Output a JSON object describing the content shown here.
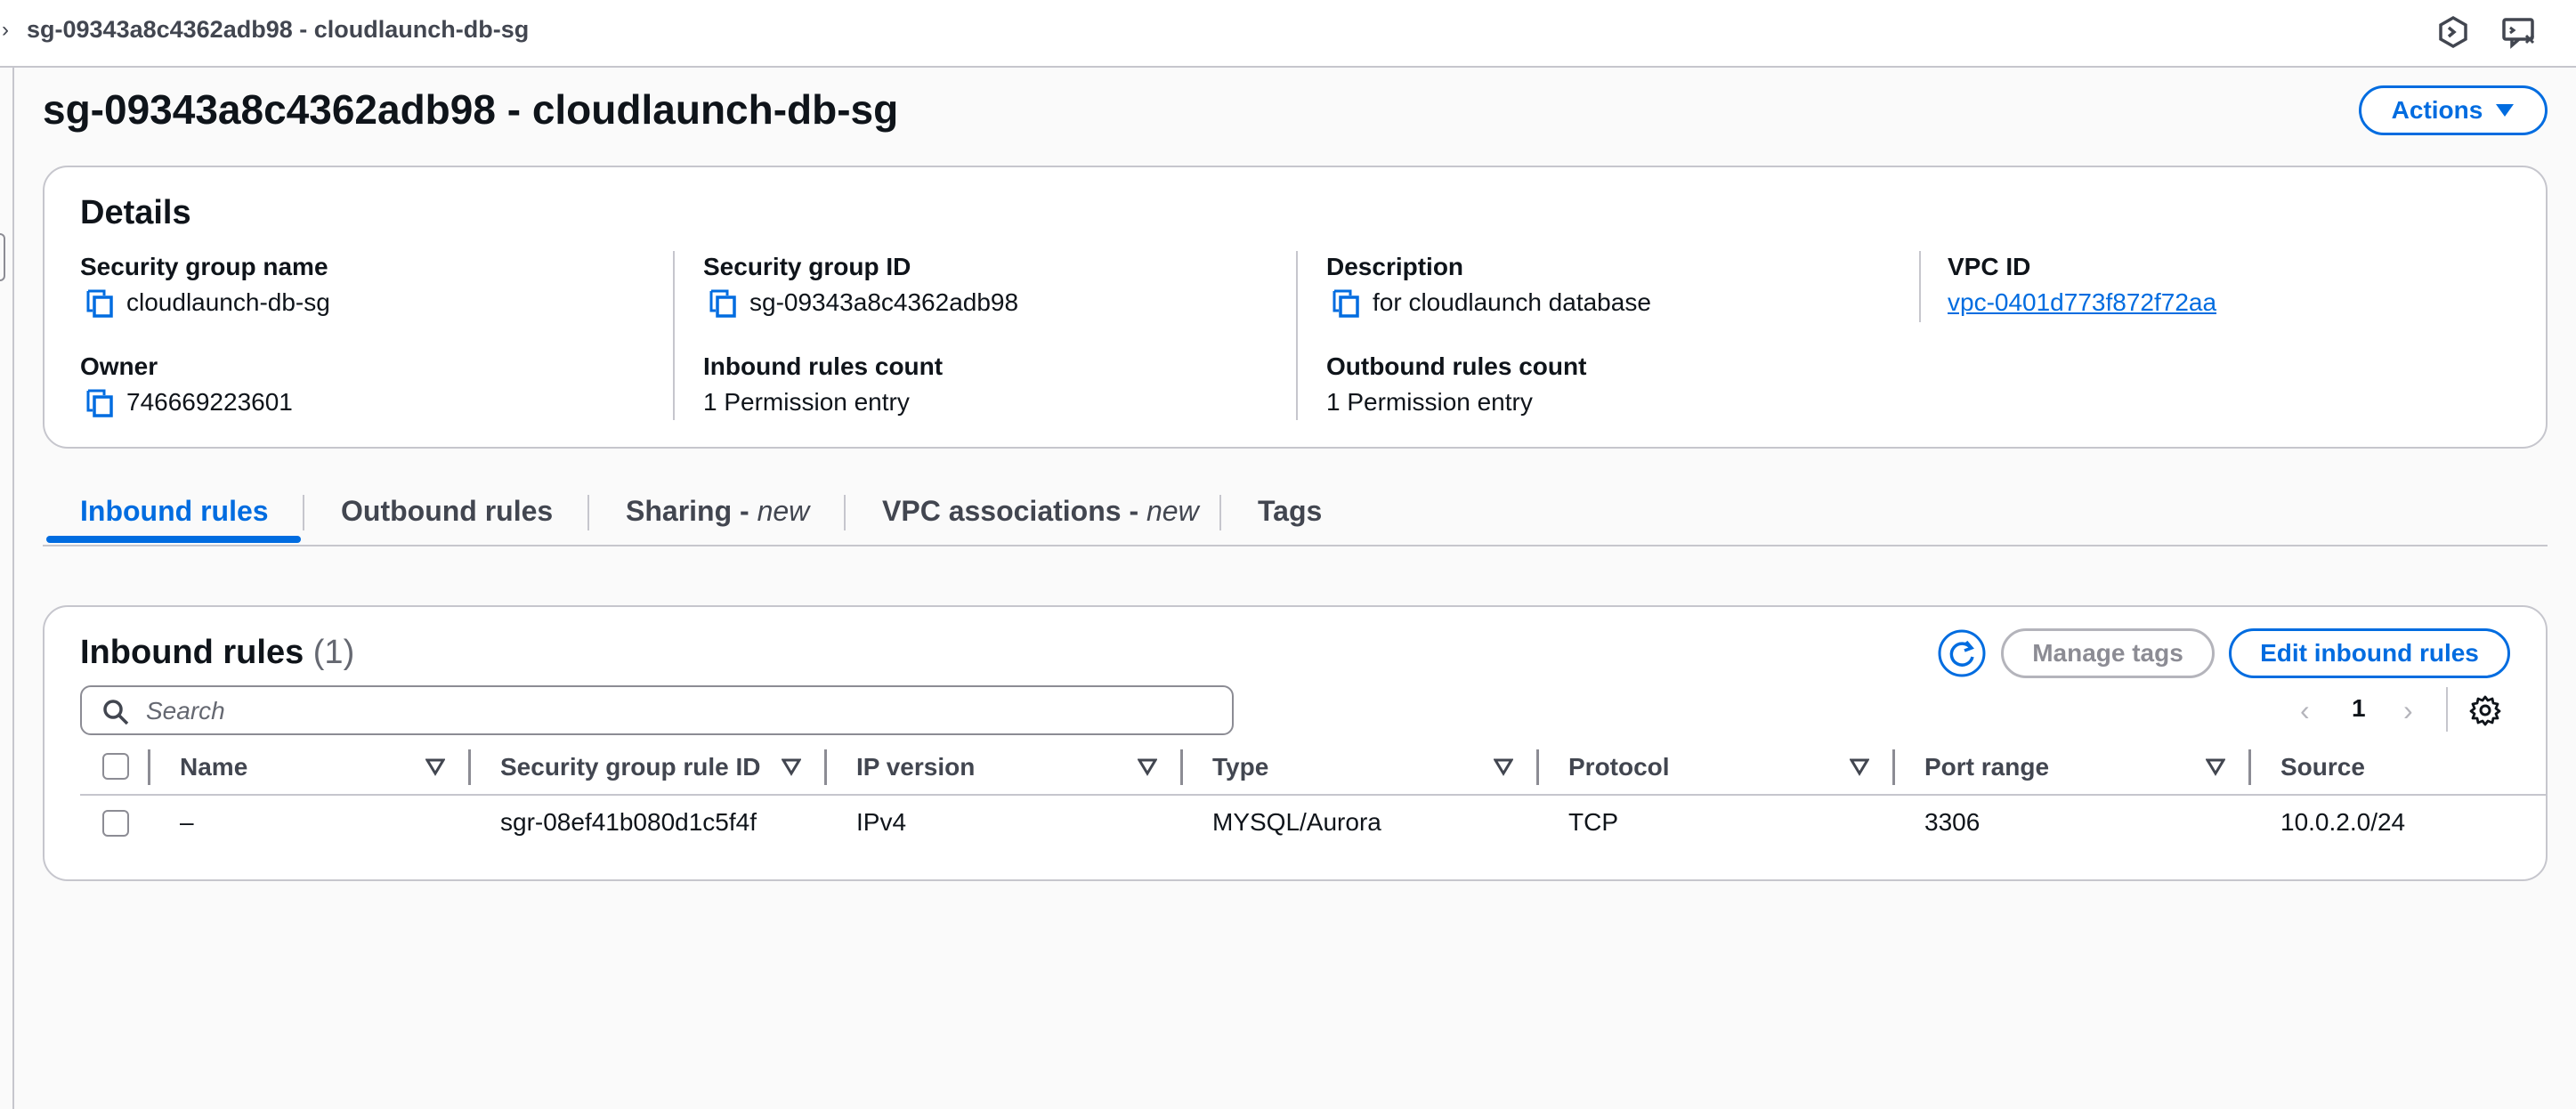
{
  "breadcrumb": {
    "current": "sg-09343a8c4362adb98 - cloudlaunch-db-sg"
  },
  "header": {
    "title": "sg-09343a8c4362adb98 - cloudlaunch-db-sg",
    "actions_label": "Actions"
  },
  "details": {
    "title": "Details",
    "fields": {
      "sg_name": {
        "label": "Security group name",
        "value": "cloudlaunch-db-sg"
      },
      "sg_id": {
        "label": "Security group ID",
        "value": "sg-09343a8c4362adb98"
      },
      "description": {
        "label": "Description",
        "value": "for cloudlaunch database"
      },
      "vpc_id": {
        "label": "VPC ID",
        "value": "vpc-0401d773f872f72aa"
      },
      "owner": {
        "label": "Owner",
        "value": "746669223601"
      },
      "inbound_count": {
        "label": "Inbound rules count",
        "value": "1 Permission entry"
      },
      "outbound_count": {
        "label": "Outbound rules count",
        "value": "1 Permission entry"
      }
    }
  },
  "tabs": [
    {
      "label": "Inbound rules",
      "suffix": "",
      "active": true
    },
    {
      "label": "Outbound rules",
      "suffix": ""
    },
    {
      "label": "Sharing - ",
      "suffix": "new"
    },
    {
      "label": "VPC associations - ",
      "suffix": "new"
    },
    {
      "label": "Tags",
      "suffix": ""
    }
  ],
  "inbound": {
    "title": "Inbound rules",
    "count": "(1)",
    "manage_tags_label": "Manage tags",
    "edit_label": "Edit inbound rules",
    "search_placeholder": "Search",
    "page": "1",
    "columns": [
      "Name",
      "Security group rule ID",
      "IP version",
      "Type",
      "Protocol",
      "Port range",
      "Source"
    ],
    "rows": [
      [
        "–",
        "sgr-08ef41b080d1c5f4f",
        "IPv4",
        "MYSQL/Aurora",
        "TCP",
        "3306",
        "10.0.2.0/24"
      ]
    ]
  },
  "colors": {
    "accent": "#006ce0",
    "border": "#c6c6cd",
    "text": "#0f141a",
    "muted": "#424650"
  },
  "icons": {
    "refresh": "refresh-icon",
    "copy": "copy-icon",
    "search": "search-icon",
    "settings": "gear-icon",
    "sort": "sort-caret-icon"
  }
}
